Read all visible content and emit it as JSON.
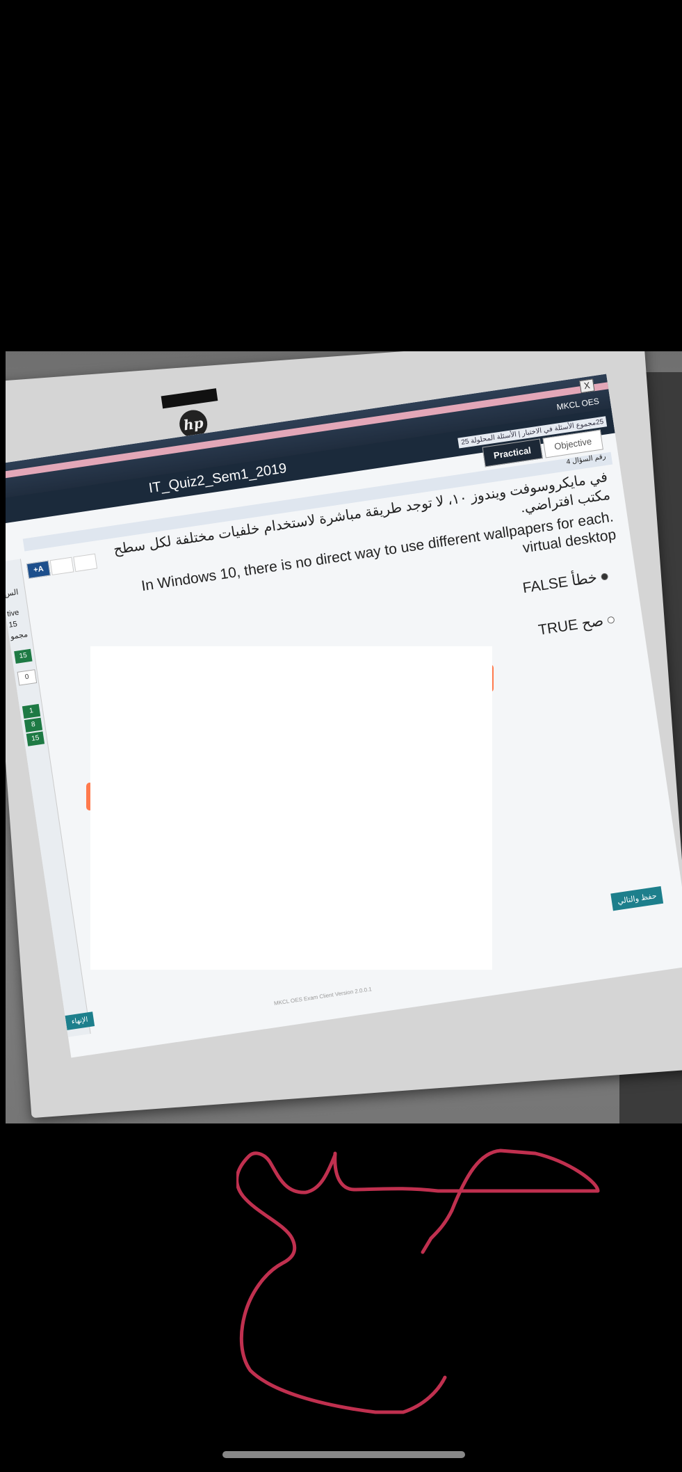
{
  "device": {
    "brand_logo": "hp"
  },
  "window": {
    "brand": "MKCL OES",
    "close_label": "X",
    "exam_title": "IT_Quiz2_Sem1_2019",
    "question_count_strip": "25مجموع الأسئلة في الاختبار | الأسئلة المحلولة 25"
  },
  "tabs": [
    {
      "label": "Practical",
      "active": true
    },
    {
      "label": "Objective",
      "active": false
    }
  ],
  "question": {
    "number_label": "رقم السؤال 4",
    "font_buttons": [
      "+A",
      "",
      ""
    ],
    "text_ar": "في مايكروسوفت ويندوز ١٠، لا توجد طريقة مباشرة لاستخدام خلفيات مختلفة لكل سطح مكتب افتراضي.",
    "text_en_line1": "In Windows 10, there is no direct way to use different wallpapers for each.",
    "text_en_line2": "virtual desktop"
  },
  "options": [
    {
      "label": "خطأ FALSE",
      "selected": true
    },
    {
      "label": "صح TRUE",
      "selected": false
    }
  ],
  "left_panel": {
    "label_1": "الس",
    "label_2": "tive",
    "label_3": "15",
    "label_4": "مجمو",
    "green_count": "15",
    "white_count": "0",
    "palette": [
      "1",
      "8",
      "15"
    ]
  },
  "buttons": {
    "save_next": "حفظ والتالي",
    "finish": "الإنهاء"
  },
  "footer": {
    "version": "MKCL OES Exam Client Version 2.0.0.1"
  },
  "colors": {
    "signature_stroke": "#c0304f",
    "accent_teal": "#1d7f8c"
  }
}
